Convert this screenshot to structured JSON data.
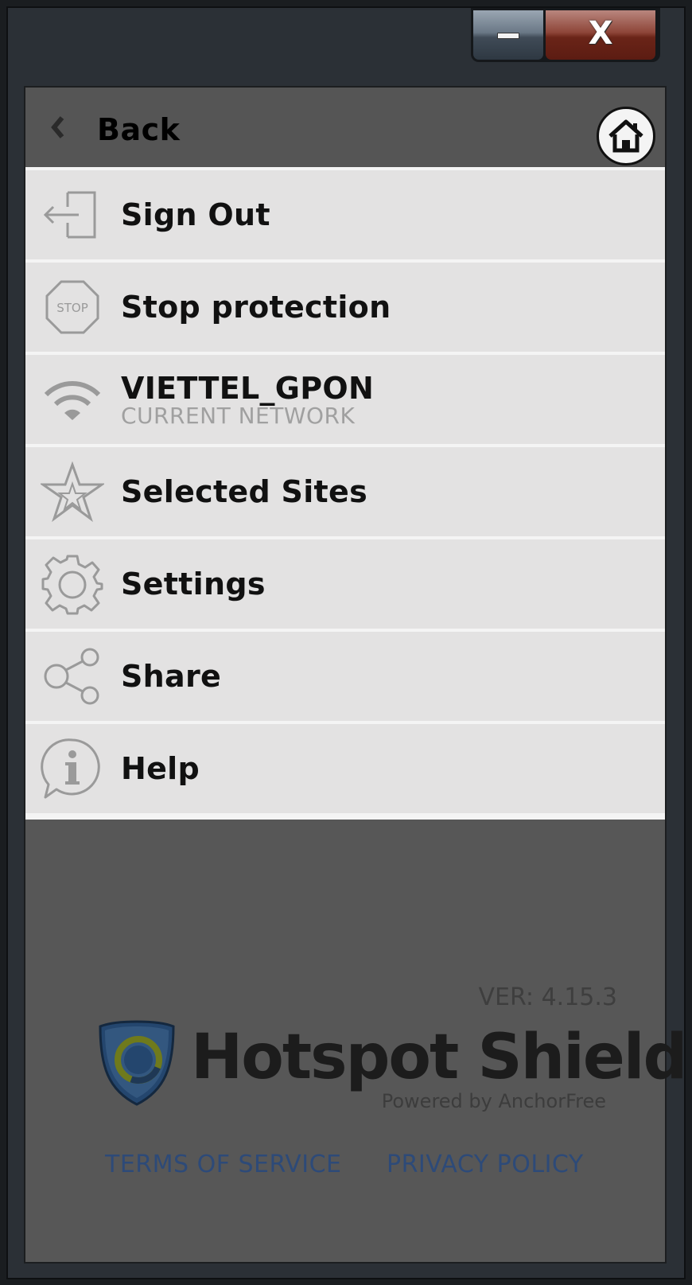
{
  "window": {
    "minimize_icon": "minimize-icon",
    "close_label": "X"
  },
  "header": {
    "back_icon": "chevron-left-icon",
    "back_label": "Back",
    "home_icon": "home-icon"
  },
  "menu": {
    "items": [
      {
        "label": "Sign Out",
        "icon": "sign-out-icon"
      },
      {
        "label": "Stop protection",
        "icon": "stop-sign-icon",
        "icon_text": "STOP"
      },
      {
        "label": "VIETTEL_GPON",
        "sub": "CURRENT NETWORK",
        "icon": "wifi-icon"
      },
      {
        "label": "Selected Sites",
        "icon": "star-icon"
      },
      {
        "label": "Settings",
        "icon": "gear-icon"
      },
      {
        "label": "Share",
        "icon": "share-icon"
      },
      {
        "label": "Help",
        "icon": "info-icon"
      }
    ]
  },
  "version": "VER: 4.15.3",
  "brand": {
    "name": "Hotspot Shield",
    "tagline": "Powered by AnchorFree",
    "logo_icon": "shield-logo-icon"
  },
  "footer": {
    "terms": "TERMS OF SERVICE",
    "privacy": "PRIVACY POLICY"
  },
  "colors": {
    "menu_bg": "#e3e2e2",
    "panel_bg": "#575757",
    "link": "#2d4a78",
    "close_button": "#8e4538"
  }
}
